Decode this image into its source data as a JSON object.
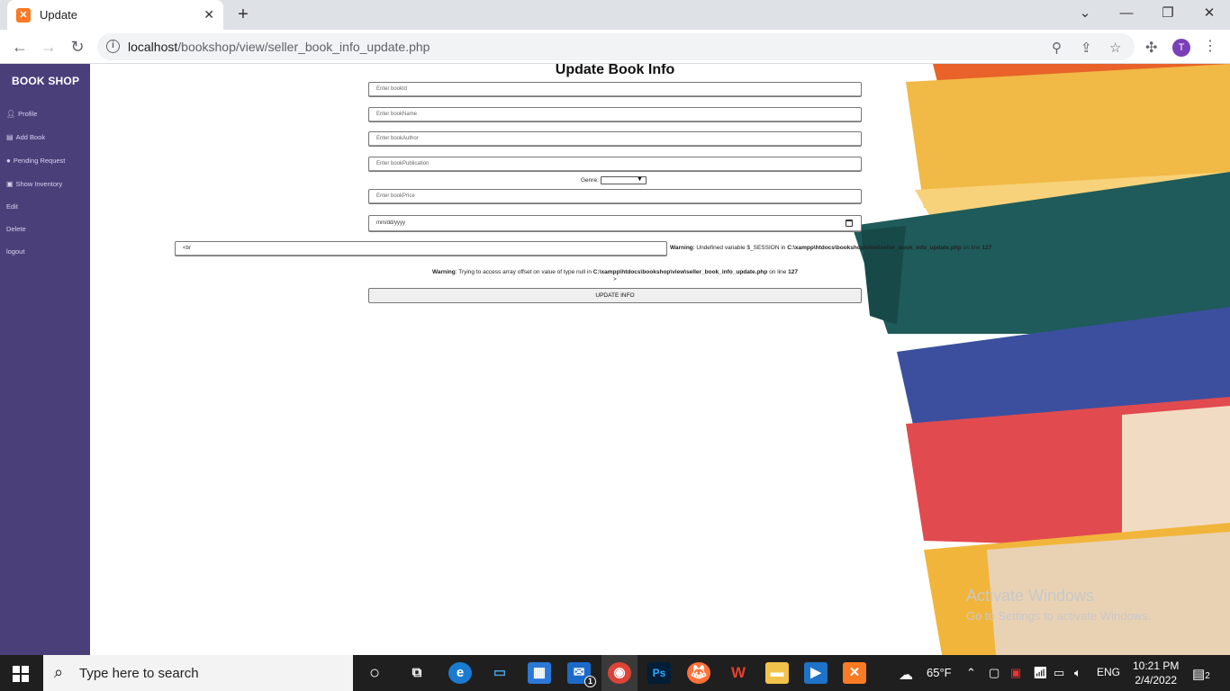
{
  "browser": {
    "tab_title": "Update",
    "url_host": "localhost",
    "url_path": "/bookshop/view/seller_book_info_update.php",
    "profile_initial": "T"
  },
  "sidebar": {
    "brand": "BOOK SHOP",
    "items": [
      {
        "label": "Profile",
        "icon": "person-icon"
      },
      {
        "label": "Add Book",
        "icon": "book-add-icon"
      },
      {
        "label": "Pending Request",
        "icon": "circle-icon"
      },
      {
        "label": "Show Inventory",
        "icon": "box-icon"
      },
      {
        "label": "Edit",
        "icon": ""
      },
      {
        "label": "Delete",
        "icon": ""
      },
      {
        "label": "logout",
        "icon": ""
      }
    ]
  },
  "form": {
    "title": "Update Book Info",
    "book_id_placeholder": "Enter bookId",
    "book_name_placeholder": "Enter bookName",
    "book_author_placeholder": "Enter bookAuthor",
    "book_publication_placeholder": "Enter bookPublication",
    "genre_label": "Genre:",
    "book_price_placeholder": "Enter bookPrice",
    "date_placeholder": "mm/dd/yyyy",
    "description_value": "<br",
    "submit_label": "UPDATE INFO"
  },
  "warnings": {
    "w1_label": "Warning",
    "w1_text": ": Undefined variable $_SESSION in ",
    "w1_path": "C:\\xampp\\htdocs\\bookshop\\view\\seller_book_info_update.php",
    "w1_line_prefix": " on line ",
    "w1_line": "127",
    "w2_label": "Warning",
    "w2_text": ": Trying to access array offset on value of type null in ",
    "w2_path": "C:\\xampp\\htdocs\\bookshop\\view\\seller_book_info_update.php",
    "w2_line_prefix": " on line ",
    "w2_line": "127",
    "gt": ">"
  },
  "watermark": {
    "heading": "Activate Windows",
    "sub": "Go to Settings to activate Windows."
  },
  "taskbar": {
    "search_placeholder": "Type here to search",
    "weather": "65°F",
    "language": "ENG",
    "time": "10:21 PM",
    "date": "2/4/2022",
    "notifications": "2",
    "mail_badge": "1"
  },
  "colors": {
    "sidebar_bg": "#4b3f7a",
    "accent_profile": "#7b3fb8"
  }
}
